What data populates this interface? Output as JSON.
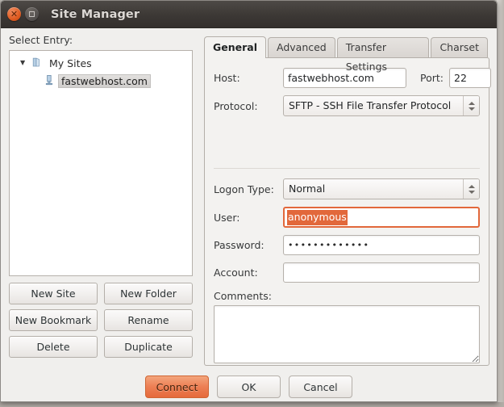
{
  "window": {
    "title": "Site Manager",
    "close_icon": "close-icon",
    "maximize_icon": "maximize-icon"
  },
  "sidebar": {
    "label": "Select Entry:",
    "tree": [
      {
        "label": "My Sites",
        "icon": "folder-icon",
        "twisty": "▼",
        "level": 0,
        "selected": false
      },
      {
        "label": "fastwebhost.com",
        "icon": "server-icon",
        "level": 1,
        "selected": true
      }
    ],
    "buttons": [
      {
        "label": "New Site"
      },
      {
        "label": "New Folder"
      },
      {
        "label": "New Bookmark"
      },
      {
        "label": "Rename"
      },
      {
        "label": "Delete"
      },
      {
        "label": "Duplicate"
      }
    ]
  },
  "tabs": [
    {
      "label": "General",
      "active": true
    },
    {
      "label": "Advanced",
      "active": false
    },
    {
      "label": "Transfer Settings",
      "active": false
    },
    {
      "label": "Charset",
      "active": false
    }
  ],
  "general": {
    "host_label": "Host:",
    "host_value": "fastwebhost.com",
    "port_label": "Port:",
    "port_value": "22",
    "protocol_label": "Protocol:",
    "protocol_value": "SFTP - SSH File Transfer Protocol",
    "logon_label": "Logon Type:",
    "logon_value": "Normal",
    "user_label": "User:",
    "user_value": "anonymous",
    "password_label": "Password:",
    "password_value": "•••••••••••••",
    "account_label": "Account:",
    "account_value": "",
    "comments_label": "Comments:",
    "comments_value": ""
  },
  "actions": [
    {
      "label": "Connect",
      "primary": true
    },
    {
      "label": "OK",
      "primary": false
    },
    {
      "label": "Cancel",
      "primary": false
    }
  ],
  "colors": {
    "accent": "#e2683b",
    "titlebar": "#3c3835",
    "dialog_bg": "#f0efed"
  }
}
